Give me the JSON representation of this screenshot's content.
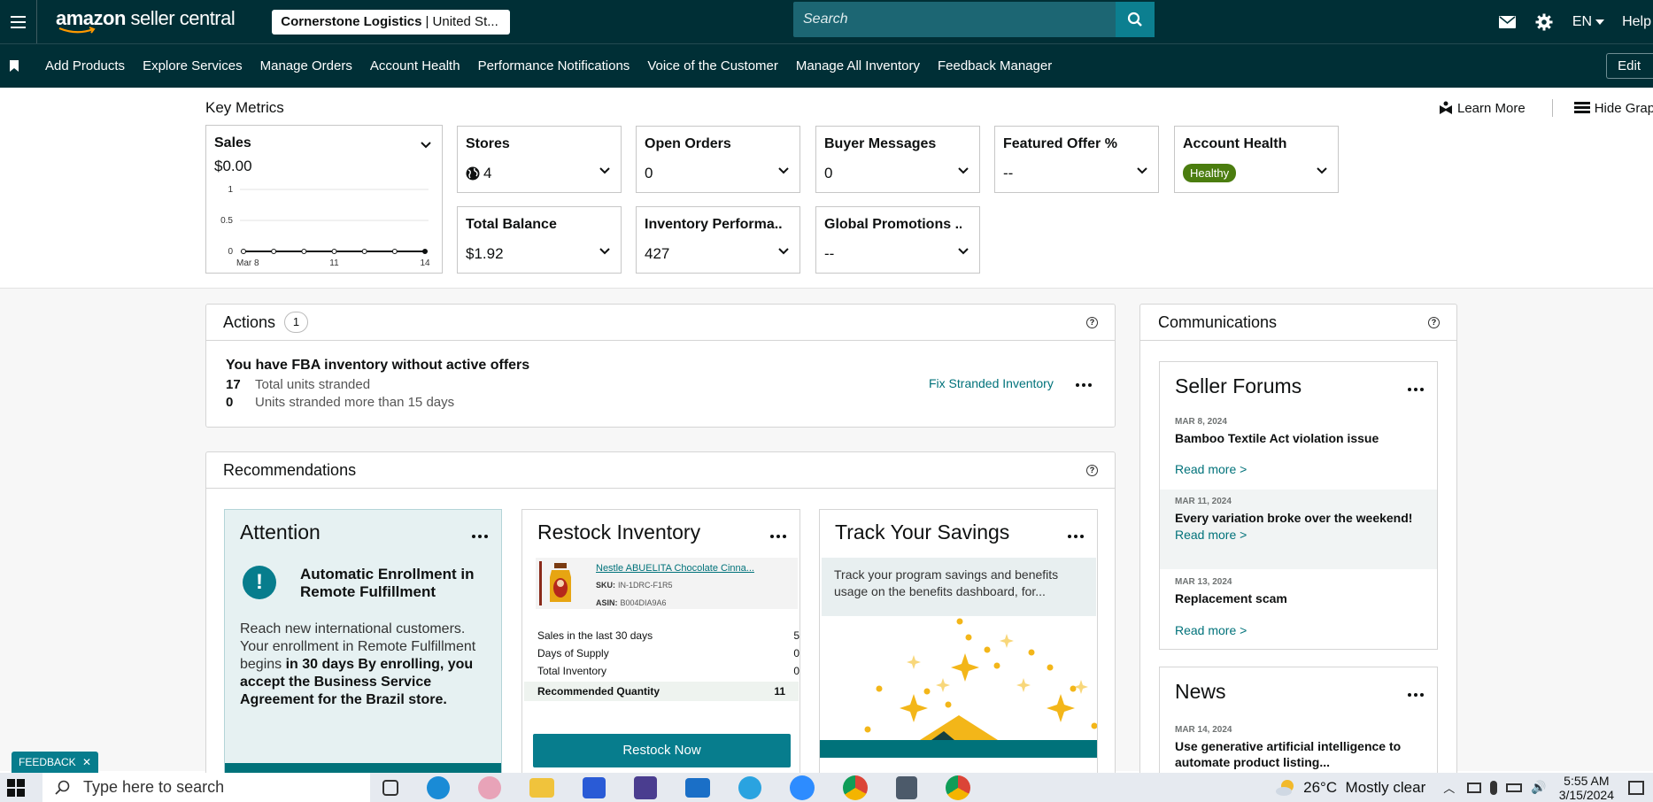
{
  "header": {
    "logo_text_bold": "amazon",
    "logo_text_rest": " seller central",
    "store_name": "Cornerstone Logistics",
    "store_region": "| United St...",
    "search_placeholder": "Search",
    "language": "EN",
    "help": "Help"
  },
  "nav": {
    "links": [
      "Add Products",
      "Explore Services",
      "Manage Orders",
      "Account Health",
      "Performance Notifications",
      "Voice of the Customer",
      "Manage All Inventory",
      "Feedback Manager"
    ],
    "edit": "Edit"
  },
  "key_metrics": {
    "title": "Key Metrics",
    "learn_more": "Learn More",
    "hide_graph": "Hide Graph",
    "sales": {
      "title": "Sales",
      "value": "$0.00"
    },
    "stores": {
      "title": "Stores",
      "value": "4"
    },
    "open_orders": {
      "title": "Open Orders",
      "value": "0"
    },
    "buyer_messages": {
      "title": "Buyer Messages",
      "value": "0"
    },
    "featured_offer": {
      "title": "Featured Offer %",
      "value": "--"
    },
    "account_health": {
      "title": "Account Health",
      "value": "Healthy"
    },
    "total_balance": {
      "title": "Total Balance",
      "value": "$1.92"
    },
    "inventory_performance": {
      "title": "Inventory Performa...",
      "value": "427"
    },
    "global_promotions": {
      "title": "Global Promotions ...",
      "value": "--"
    }
  },
  "chart_data": {
    "type": "line",
    "title": "",
    "x": [
      "Mar 8",
      "Mar 9",
      "Mar 10",
      "Mar 11",
      "Mar 12",
      "Mar 13",
      "Mar 14"
    ],
    "x_tick_labels": [
      "Mar 8",
      "11",
      "14"
    ],
    "series": [
      {
        "values": [
          0,
          0,
          0,
          0,
          0,
          0,
          0
        ]
      }
    ],
    "y_ticks": [
      "1",
      "0.5",
      "0"
    ],
    "ylim": [
      0,
      1
    ],
    "grid": "horizontal"
  },
  "actions": {
    "title": "Actions",
    "count": "1",
    "item_title": "You have FBA inventory without active offers",
    "row1_value": "17",
    "row1_label": "Total units stranded",
    "row2_value": "0",
    "row2_label": "Units stranded more than 15 days",
    "link": "Fix Stranded Inventory"
  },
  "recommendations": {
    "title": "Recommendations",
    "attention": {
      "title": "Attention",
      "heading": "Automatic Enrollment in Remote Fulfillment",
      "body_plain": "Reach new international customers. Your enrollment in Remote Fulfillment begins ",
      "body_bold": "in 30 days By enrolling, you accept the Business Service Agreement for the Brazil store."
    },
    "restock": {
      "title": "Restock Inventory",
      "product_name": "Nestle ABUELITA Chocolate Cinna...",
      "sku_label": "SKU:",
      "sku": "IN-1DRC-F1R5",
      "asin_label": "ASIN:",
      "asin": "B004DIA9A6",
      "sales_label": "Sales in the last 30 days",
      "sales_value": "5",
      "days_label": "Days of Supply",
      "days_value": "0",
      "inventory_label": "Total Inventory",
      "inventory_value": "0",
      "rec_qty_label": "Recommended Quantity",
      "rec_qty_value": "11",
      "button": "Restock Now"
    },
    "savings": {
      "title": "Track Your Savings",
      "body": "Track your program savings and benefits usage on the benefits dashboard, for..."
    }
  },
  "communications": {
    "title": "Communications",
    "forums": {
      "title": "Seller Forums",
      "posts": [
        {
          "date": "MAR 8, 2024",
          "title": "Bamboo Textile Act violation issue",
          "link": "Read more >"
        },
        {
          "date": "MAR 11, 2024",
          "title": "Every variation broke over the weekend!",
          "link": "Read more >"
        },
        {
          "date": "MAR 13, 2024",
          "title": "Replacement scam",
          "link": "Read more >"
        }
      ]
    },
    "news": {
      "title": "News",
      "posts": [
        {
          "date": "MAR 14, 2024",
          "title": "Use generative artificial intelligence to automate product listing..."
        }
      ]
    }
  },
  "feedback": "FEEDBACK",
  "taskbar": {
    "search_placeholder": "Type here to search",
    "weather": "26°C  Mostly clear",
    "time": "5:55 AM",
    "date": "3/15/2024"
  }
}
